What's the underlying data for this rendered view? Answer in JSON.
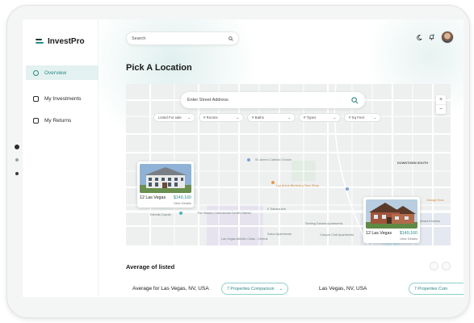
{
  "app": {
    "name": "InvestPro"
  },
  "sidebar": {
    "items": [
      {
        "label": "Overview",
        "icon": "dashboard-icon",
        "active": true
      },
      {
        "label": "My Investments",
        "icon": "building-icon",
        "active": false
      },
      {
        "label": "My Returns",
        "icon": "wallet-icon",
        "active": false
      }
    ]
  },
  "topbar": {
    "search_placeholder": "Search",
    "icons": [
      "moon-icon",
      "bell-icon",
      "avatar"
    ]
  },
  "page": {
    "title": "Pick A Location"
  },
  "map": {
    "search_placeholder": "Enter Street Address",
    "filters": [
      {
        "label": "Listed For sale"
      },
      {
        "label": "# Rooms"
      },
      {
        "label": "# Baths"
      },
      {
        "label": "# Types"
      },
      {
        "label": "# Sq Feet"
      }
    ],
    "zoom_in": "+",
    "zoom_out": "−",
    "listings": [
      {
        "location": "12 Las Vegas",
        "price": "$149,160",
        "detail": "View Details"
      },
      {
        "location": "12 Las Vegas",
        "price": "$149,160",
        "detail": "View Details"
      }
    ],
    "labels": {
      "church": "St. Anne's Catholic Church",
      "downtown": "DOWNTOWN SOUTH",
      "commercial": "The Historic Commercial Center District",
      "estrella": "Estrella Cayuto",
      "sahara": "E Sahara Ave",
      "athletic": "Las Vegas Athletic Clubs - Central",
      "sterling": "Sterling Sahara Apartments",
      "canyon": "Canyon Club Apartments",
      "salon": "Salon Apartments",
      "tacos": "Los Arcos Birrieria y Taco Shop",
      "stage": "Garage Door",
      "flex": "Sahara Express"
    },
    "colors": {
      "accent": "#2c8a86",
      "map_bg": "#eef0f0",
      "road": "#ffffff"
    }
  },
  "average": {
    "title": "Average of listed",
    "rows": [
      {
        "label": "Average for Las Vegas, NV, USA",
        "button": "7 Properties Comparison"
      },
      {
        "label": "Las Vegas, NV, USA",
        "button": "7 Properties Com"
      }
    ]
  }
}
